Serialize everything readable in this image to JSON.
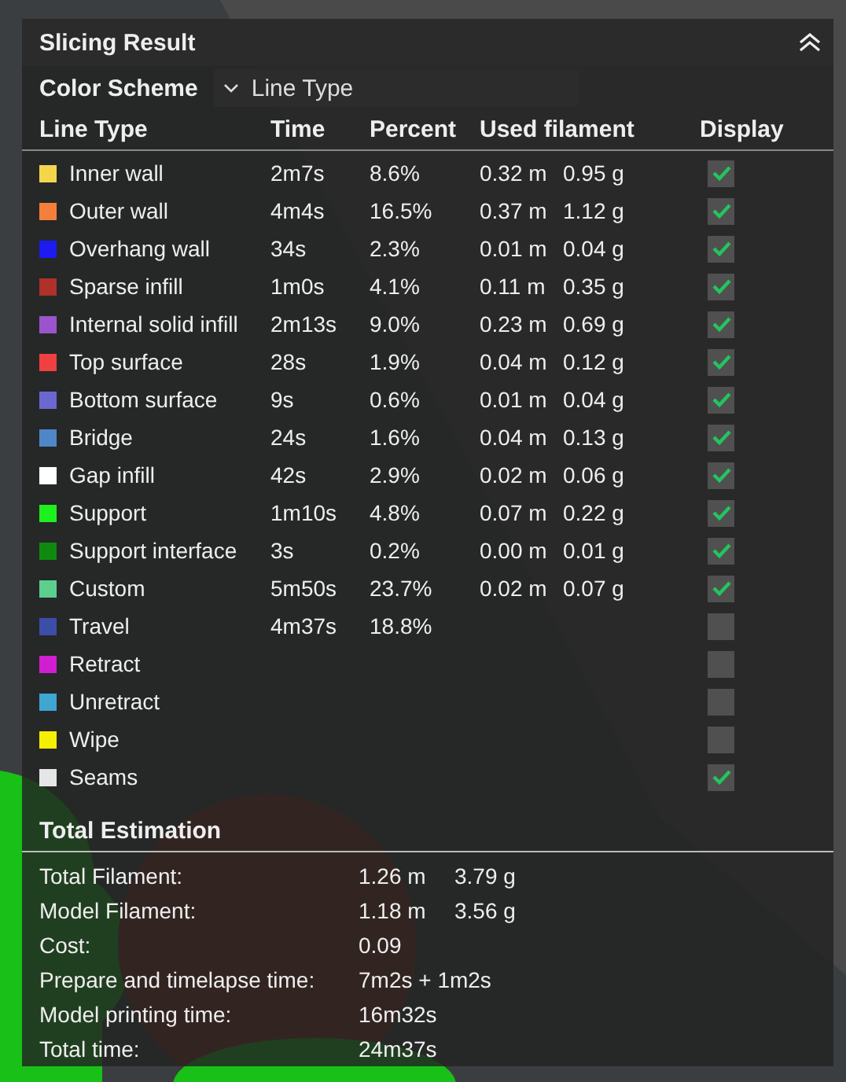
{
  "panel": {
    "title": "Slicing Result"
  },
  "color_scheme": {
    "label": "Color Scheme",
    "value": "Line Type"
  },
  "table": {
    "columns": [
      "Line Type",
      "Time",
      "Percent",
      "Used filament",
      "Display"
    ],
    "rows": [
      {
        "name": "Inner wall",
        "color": "#f5d64a",
        "time": "2m7s",
        "percent": "8.6%",
        "length": "0.32 m",
        "weight": "0.95 g",
        "display": true
      },
      {
        "name": "Outer wall",
        "color": "#f47f3a",
        "time": "4m4s",
        "percent": "16.5%",
        "length": "0.37 m",
        "weight": "1.12 g",
        "display": true
      },
      {
        "name": "Overhang wall",
        "color": "#1c1cf0",
        "time": "34s",
        "percent": "2.3%",
        "length": "0.01 m",
        "weight": "0.04 g",
        "display": true
      },
      {
        "name": "Sparse infill",
        "color": "#b0302a",
        "time": "1m0s",
        "percent": "4.1%",
        "length": "0.11 m",
        "weight": "0.35 g",
        "display": true
      },
      {
        "name": "Internal solid infill",
        "color": "#9a55cc",
        "time": "2m13s",
        "percent": "9.0%",
        "length": "0.23 m",
        "weight": "0.69 g",
        "display": true
      },
      {
        "name": "Top surface",
        "color": "#f04040",
        "time": "28s",
        "percent": "1.9%",
        "length": "0.04 m",
        "weight": "0.12 g",
        "display": true
      },
      {
        "name": "Bottom surface",
        "color": "#6a68d0",
        "time": "9s",
        "percent": "0.6%",
        "length": "0.01 m",
        "weight": "0.04 g",
        "display": true
      },
      {
        "name": "Bridge",
        "color": "#4f86c8",
        "time": "24s",
        "percent": "1.6%",
        "length": "0.04 m",
        "weight": "0.13 g",
        "display": true
      },
      {
        "name": "Gap infill",
        "color": "#ffffff",
        "time": "42s",
        "percent": "2.9%",
        "length": "0.02 m",
        "weight": "0.06 g",
        "display": true
      },
      {
        "name": "Support",
        "color": "#1ef01e",
        "time": "1m10s",
        "percent": "4.8%",
        "length": "0.07 m",
        "weight": "0.22 g",
        "display": true
      },
      {
        "name": "Support interface",
        "color": "#0e8a0e",
        "time": "3s",
        "percent": "0.2%",
        "length": "0.00 m",
        "weight": "0.01 g",
        "display": true
      },
      {
        "name": "Custom",
        "color": "#5ccf8f",
        "time": "5m50s",
        "percent": "23.7%",
        "length": "0.02 m",
        "weight": "0.07 g",
        "display": true
      },
      {
        "name": "Travel",
        "color": "#3c4ea8",
        "time": "4m37s",
        "percent": "18.8%",
        "display": false
      },
      {
        "name": "Retract",
        "color": "#d01ed0",
        "display": false
      },
      {
        "name": "Unretract",
        "color": "#3ea6d0",
        "display": false
      },
      {
        "name": "Wipe",
        "color": "#f5f000",
        "display": false
      },
      {
        "name": "Seams",
        "color": "#e6e6e6",
        "display": true
      }
    ]
  },
  "total": {
    "title": "Total Estimation",
    "rows": [
      {
        "label": "Total Filament:",
        "values": [
          "1.26 m",
          "3.79 g"
        ]
      },
      {
        "label": "Model Filament:",
        "values": [
          "1.18 m",
          "3.56 g"
        ]
      },
      {
        "label": "Cost:",
        "values": [
          "0.09"
        ]
      },
      {
        "label": "Prepare and timelapse time:",
        "values": [
          "7m2s + 1m2s"
        ]
      },
      {
        "label": "Model printing time:",
        "values": [
          "16m32s"
        ]
      },
      {
        "label": "Total time:",
        "values": [
          "24m37s"
        ]
      }
    ]
  }
}
